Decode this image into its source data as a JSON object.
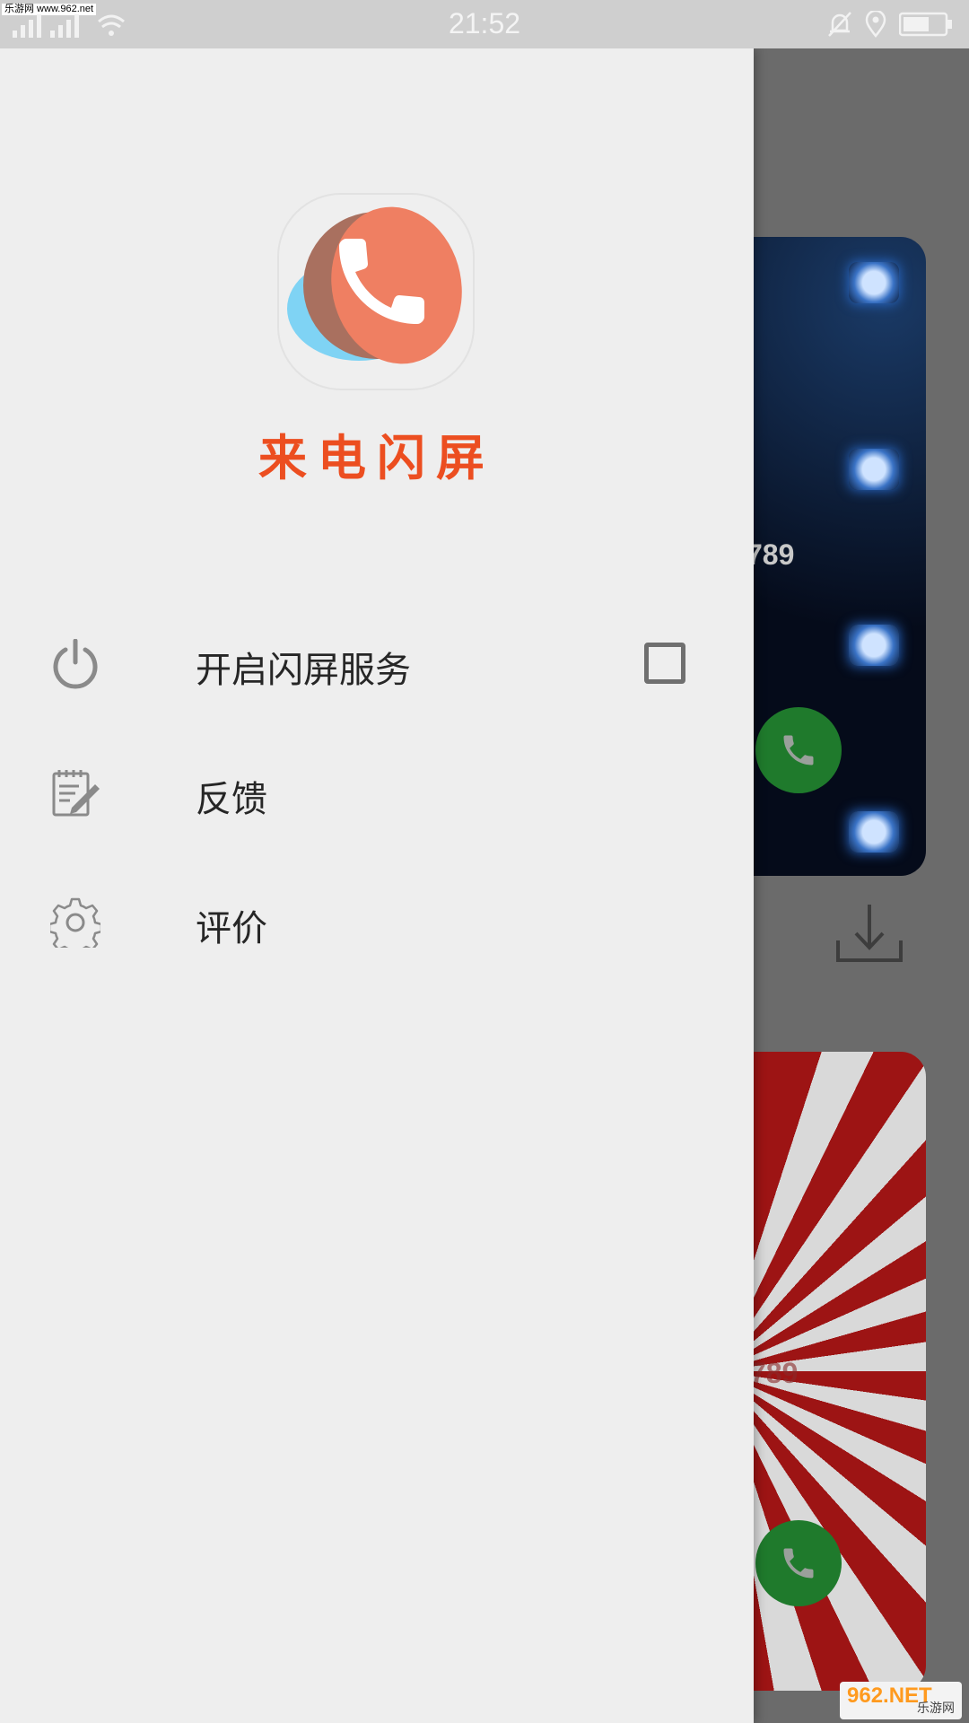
{
  "status_bar": {
    "watermark": "乐游网 www.962.net",
    "time": "21:52"
  },
  "drawer": {
    "app_name": "来电闪屏",
    "menu": [
      {
        "label": "开启闪屏服务",
        "icon": "power-icon",
        "checkbox_checked": false
      },
      {
        "label": "反馈",
        "icon": "edit-note-icon"
      },
      {
        "label": "评价",
        "icon": "gear-icon"
      }
    ]
  },
  "background": {
    "card1_number": "789",
    "card2_number": "789",
    "watermark_brand": "962.NET",
    "watermark_sub": "乐游网"
  },
  "colors": {
    "accent": "#ec4e20",
    "drawer_bg": "#eeeeee",
    "call_green": "#1f7a2c"
  }
}
